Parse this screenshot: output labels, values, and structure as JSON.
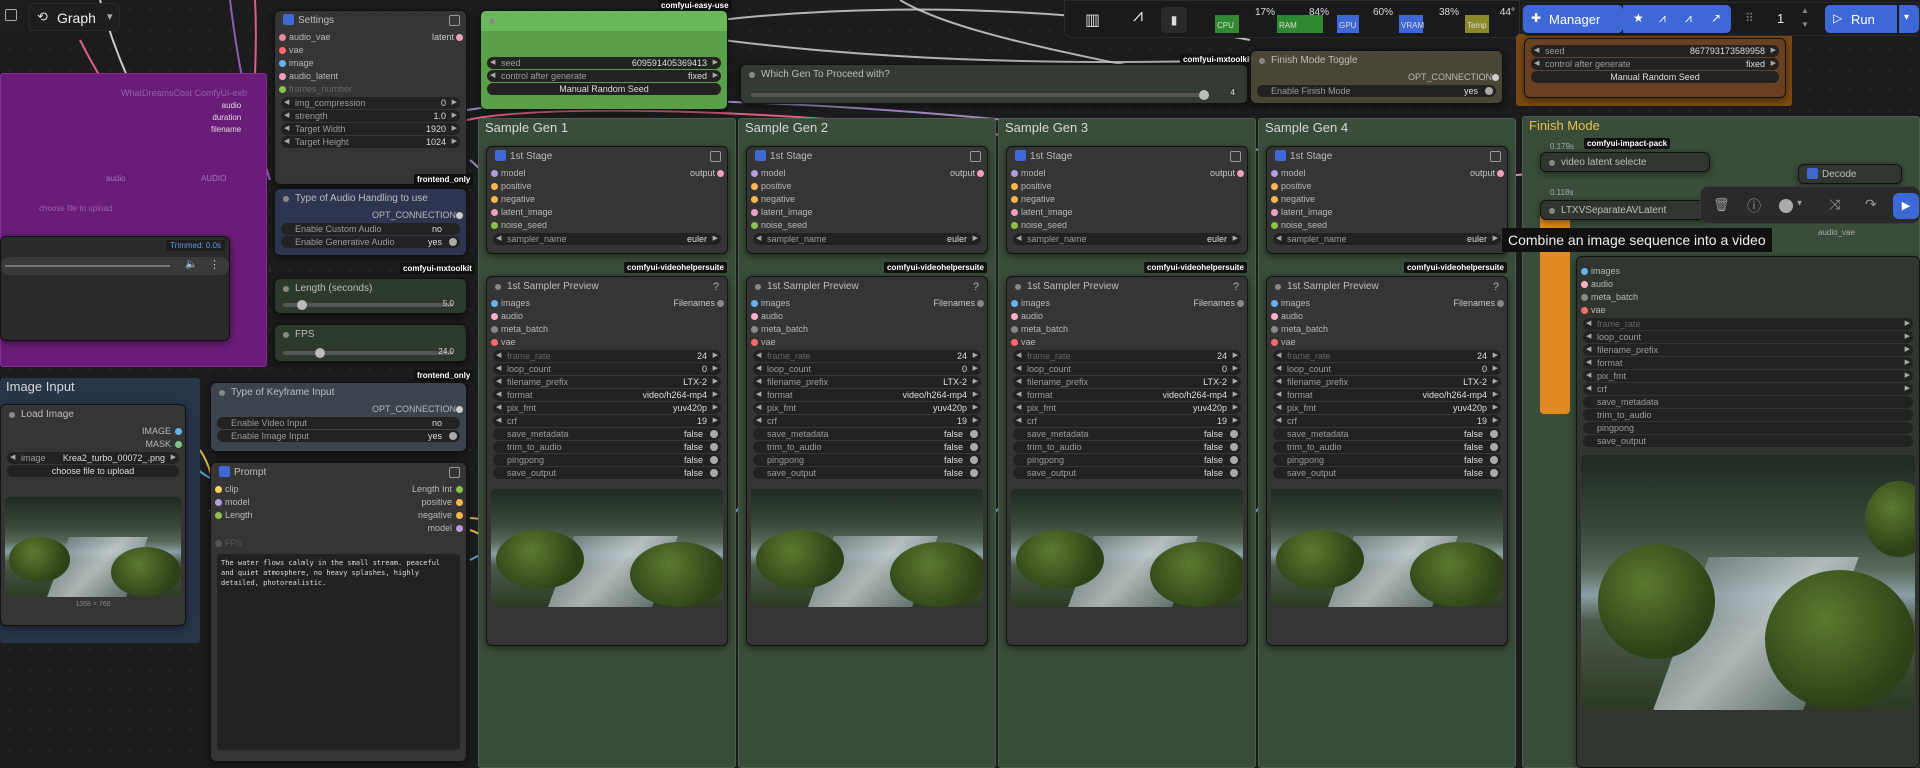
{
  "graph": {
    "label": "Graph"
  },
  "resources": {
    "cpu_label": "CPU",
    "cpu": "17%",
    "ram_label": "RAM",
    "ram": "84%",
    "gpu_label": "GPU",
    "gpu": "60%",
    "vram_label": "VRAM",
    "vram": "38%",
    "temp_label": "Temp",
    "temp": "44°"
  },
  "manager": {
    "label": "Manager",
    "queue_count": "1",
    "run_label": "Run"
  },
  "tooltip": "Combine an image sequence into a video",
  "settings": {
    "title": "Settings",
    "outputs": [
      "audio_vae",
      "vae",
      "image",
      "audio_latent",
      "frames_number"
    ],
    "latent": "latent",
    "widgets": [
      {
        "label": "img_compression",
        "value": "0"
      },
      {
        "label": "strength",
        "value": "1.0"
      },
      {
        "label": "Target Width",
        "value": "1920"
      },
      {
        "label": "Target Height",
        "value": "1024"
      }
    ],
    "footer": "frontend_only"
  },
  "faded": {
    "title": "WhatDreamsCost ComfyUI-exb",
    "outs": [
      "audio",
      "duration",
      "filename"
    ],
    "in1": "audio",
    "in2": "AUDIO",
    "in3": "choose file to upload"
  },
  "audioplayer": {
    "trim": "Trimmed: 0.0s"
  },
  "seed_left": {
    "seed_label": "seed",
    "seed": "609591405369413",
    "cag_label": "control after generate",
    "cag": "fixed",
    "btn": "Manual Random Seed",
    "pack": "comfyui-easy-use"
  },
  "seed_right": {
    "seed_label": "seed",
    "seed": "867793173589958",
    "cag_label": "control after generate",
    "cag": "fixed",
    "btn": "Manual Random Seed"
  },
  "which_gen": {
    "title": "Which Gen To Proceed with?",
    "value": "4",
    "pack": "comfyui-mxtoolkit"
  },
  "finish_toggle": {
    "title": "Finish Mode Toggle",
    "out": "OPT_CONNECTION",
    "label": "Enable Finish Mode",
    "value": "yes"
  },
  "audio_handling": {
    "title": "Type of Audio Handling to use",
    "out": "OPT_CONNECTION",
    "w1": "Enable Custom Audio",
    "v1": "no",
    "w2": "Enable Generative Audio",
    "v2": "yes",
    "pack": "comfyui-mxtoolkit"
  },
  "length": {
    "title": "Length (seconds)",
    "value": "5.0",
    "pack": "comfyui-mxtoolkit"
  },
  "fps": {
    "title": "FPS",
    "value": "24.0",
    "footer": "frontend_only"
  },
  "image_input": {
    "title": "Image Input"
  },
  "load_image": {
    "title": "Load Image",
    "out1": "IMAGE",
    "out2": "MASK",
    "image_label": "image",
    "image": "Krea2_turbo_00072_.png",
    "upload": "choose file to upload",
    "dims": "1368 × 768"
  },
  "keyframe": {
    "title": "Type of Keyframe Input",
    "out": "OPT_CONNECTION",
    "w1": "Enable Video Input",
    "v1": "no",
    "w2": "Enable Image Input",
    "v2": "yes"
  },
  "prompt": {
    "title": "Prompt",
    "ins": [
      "clip",
      "model",
      "Length"
    ],
    "outs": [
      "Length Int",
      "positive",
      "negative",
      "model"
    ],
    "fps": "FPS",
    "text": "The water flows calmly in the small stream.  peaceful and quiet atmosphere, no heavy splashes, highly detailed, photorealistic."
  },
  "gens": [
    {
      "title": "Sample Gen 1"
    },
    {
      "title": "Sample Gen 2"
    },
    {
      "title": "Sample Gen 3"
    },
    {
      "title": "Sample Gen 4"
    }
  ],
  "stage": {
    "title": "1st Stage",
    "inputs": [
      "model",
      "positive",
      "negative",
      "latent_image",
      "noise_seed"
    ],
    "output": "output",
    "sampler_label": "sampler_name",
    "sampler": "euler",
    "pack": "comfyui-videohelpersuite"
  },
  "preview": {
    "title": "1st Sampler Preview",
    "inputs": [
      "images",
      "audio",
      "meta_batch",
      "vae"
    ],
    "out": "Filenames",
    "widgets": [
      {
        "label": "frame_rate",
        "value": "24"
      },
      {
        "label": "loop_count",
        "value": "0"
      },
      {
        "label": "filename_prefix",
        "value": "LTX-2"
      },
      {
        "label": "format",
        "value": "video/h264-mp4"
      },
      {
        "label": "pix_fmt",
        "value": "yuv420p"
      },
      {
        "label": "crf",
        "value": "19"
      },
      {
        "label": "save_metadata",
        "value": "false"
      },
      {
        "label": "trim_to_audio",
        "value": "false"
      },
      {
        "label": "pingpong",
        "value": "false"
      },
      {
        "label": "save_output",
        "value": "false"
      }
    ]
  },
  "finish_mode": {
    "title": "Finish Mode",
    "pack": "comfyui-impact-pack",
    "video_latent": "video latent selecte",
    "t1": "0.179s",
    "t2": "0.118s",
    "separate": "LTXVSeparateAVLatent",
    "decode": "Decode",
    "audio_vae": "audio_vae",
    "inputs": [
      "images",
      "audio",
      "meta_batch",
      "vae"
    ],
    "widgets": [
      "frame_rate",
      "loop_count",
      "filename_prefix",
      "format",
      "pix_fmt",
      "crf",
      "save_metadata",
      "trim_to_audio",
      "pingpong",
      "save_output"
    ]
  },
  "colors": {
    "green_group": "#3a4d3a",
    "purple_group": "#7a1f8a",
    "orange_group": "#8a5a14",
    "blue_group": "#2a3a52",
    "accent": "#3e68d6",
    "seed_green": "#5aa048"
  }
}
